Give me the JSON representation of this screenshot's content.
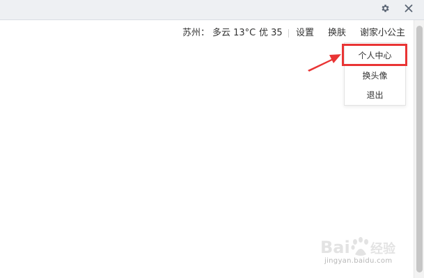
{
  "window": {
    "controls": {
      "settings_icon": "gear-icon",
      "close_icon": "close-icon"
    }
  },
  "topbar": {
    "weather": {
      "city": "苏州：",
      "condition": "多云 13°C",
      "aqi": "优 35"
    },
    "nav": {
      "settings": "设置",
      "skin": "换肤",
      "user": "谢家小公主"
    }
  },
  "user_menu": {
    "items": [
      "个人中心",
      "换头像",
      "退出"
    ],
    "highlighted_item": "个人中心"
  },
  "annotation": {
    "highlight_color": "#e93434"
  },
  "watermark": {
    "url": "jingyan.baidu.com"
  }
}
